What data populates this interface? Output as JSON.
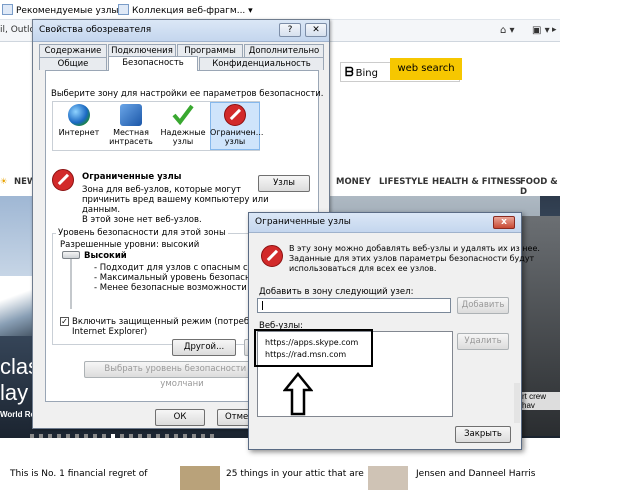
{
  "browser": {
    "favorites": [
      {
        "label": "Рекомендуемые узлы ▾"
      },
      {
        "label": "Коллекция веб-фрагм... ▾"
      }
    ],
    "address_fragment": "il, Outlo",
    "search": {
      "brand": "Bing",
      "button": "web search"
    },
    "nav_items": [
      "NEW",
      "MONEY",
      "LIFESTYLE",
      "HEALTH & FITNESS",
      "FOOD & D"
    ],
    "hero_texts": [
      "class",
      "lay |",
      "World Re",
      "rt crew hav"
    ],
    "news": [
      "This is No. 1 financial regret of",
      "25 things in your attic that are",
      "Jensen and Danneel Harris"
    ]
  },
  "options_dialog": {
    "title": "Свойства обозревателя",
    "help_btn": "?",
    "close_btn": "✕",
    "tabs_top": [
      "Содержание",
      "Подключения",
      "Программы",
      "Дополнительно"
    ],
    "tabs_bottom": [
      "Общие",
      "Безопасность",
      "Конфиденциальность"
    ],
    "zone_prompt": "Выберите зону для настройки ее параметров безопасности.",
    "zones": [
      {
        "label1": "Интернет",
        "label2": ""
      },
      {
        "label1": "Местная",
        "label2": "интрасеть"
      },
      {
        "label1": "Надежные",
        "label2": "узлы"
      },
      {
        "label1": "Ограничен...",
        "label2": "узлы"
      }
    ],
    "zone_title": "Ограниченные узлы",
    "zone_desc": [
      "Зона для веб-узлов, которые могут",
      "причинить вред вашему компьютеру или",
      "данным.",
      "В этой зоне нет веб-узлов."
    ],
    "sites_btn": "Узлы",
    "level_group": "Уровень безопасности для этой зоны",
    "allowed_levels": "Разрешенные уровни: высокий",
    "level_name": "Высокий",
    "level_bullets": [
      "- Подходит для узлов с опасным содерж",
      "- Максимальный уровень безопасности",
      "- Менее безопасные возможности отключ"
    ],
    "protected_mode": [
      "Включить защищенный режим (потребуется пер",
      "Internet Explorer)"
    ],
    "other_btn": "Другой...",
    "default_btn_fragment": "По",
    "reset_all_btn": "Выбрать уровень безопасности по умолчани",
    "ok_btn": "ОК",
    "cancel_btn": "Отмена"
  },
  "restricted_dialog": {
    "title": "Ограниченные узлы",
    "close_btn": "x",
    "info": [
      "В эту зону можно добавлять веб-узлы и удалять их из нее.",
      "Заданные для этих узлов параметры безопасности будут",
      "использоваться для всех ее узлов."
    ],
    "add_label": "Добавить в зону следующий узел:",
    "add_input_value": "",
    "add_btn": "Добавить",
    "list_label": "Веб-узлы:",
    "sites": [
      "https://apps.skype.com",
      "https://rad.msn.com"
    ],
    "remove_btn": "Удалить",
    "close_dialog_btn": "Закрыть"
  },
  "colors": {
    "accent_yellow": "#f6c700",
    "dialog_bg": "#f0f0f0",
    "restricted_red": "#d22a2a"
  }
}
